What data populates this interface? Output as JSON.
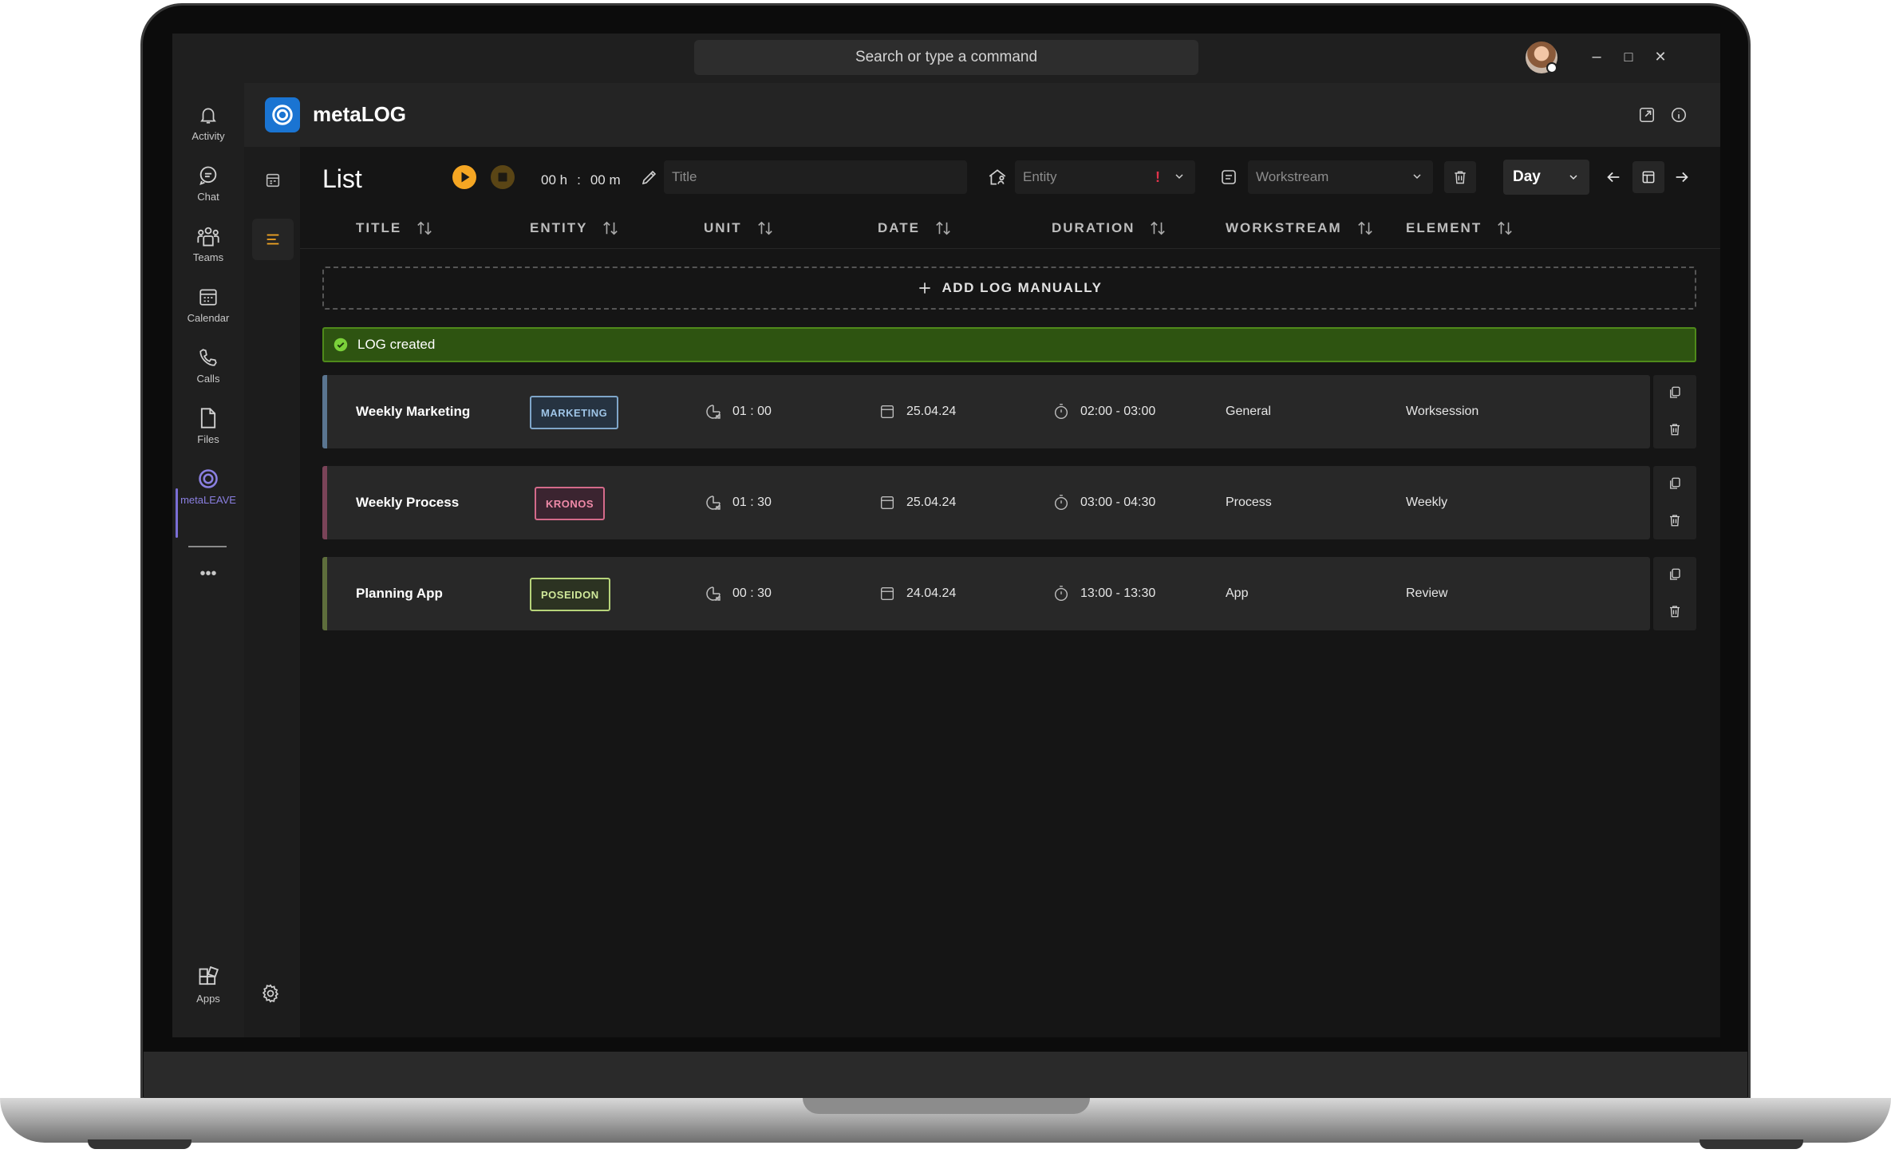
{
  "titlebar": {
    "search_placeholder": "Search or type a command",
    "minimize": "–",
    "maximize": "□",
    "close": "✕"
  },
  "rail": {
    "items": [
      {
        "label": "Activity",
        "icon": "bell-icon"
      },
      {
        "label": "Chat",
        "icon": "chat-icon"
      },
      {
        "label": "Teams",
        "icon": "teams-icon"
      },
      {
        "label": "Calendar",
        "icon": "calendar-icon"
      },
      {
        "label": "Calls",
        "icon": "phone-icon"
      },
      {
        "label": "Files",
        "icon": "file-icon"
      },
      {
        "label": "metaLEAVE",
        "icon": "metaleave-icon"
      }
    ],
    "more": "•••",
    "apps_label": "Apps"
  },
  "app": {
    "name": "metaLOG"
  },
  "toolbar": {
    "page_title": "List",
    "timer_hours": "00 h",
    "timer_sep": ":",
    "timer_minutes": "00 m",
    "title_placeholder": "Title",
    "entity_placeholder": "Entity",
    "entity_warning": "!",
    "workstream_placeholder": "Workstream",
    "period": "Day"
  },
  "table": {
    "columns": [
      "TITLE",
      "ENTITY",
      "UNIT",
      "DATE",
      "DURATION",
      "WORKSTREAM",
      "ELEMENT"
    ],
    "add_label": "ADD LOG MANUALLY",
    "toast": "LOG created",
    "rows": [
      {
        "title": "Weekly Marketing",
        "entity": "MARKETING",
        "unit": "01 : 00",
        "date": "25.04.24",
        "duration": "02:00 - 03:00",
        "workstream": "General",
        "element": "Worksession",
        "color": "#7fa6c9"
      },
      {
        "title": "Weekly Process",
        "entity": "KRONOS",
        "unit": "01 : 30",
        "date": "25.04.24",
        "duration": "03:00 - 04:30",
        "workstream": "Process",
        "element": "Weekly",
        "color": "#d46a8a"
      },
      {
        "title": "Planning App",
        "entity": "POSEIDON",
        "unit": "00 : 30",
        "date": "24.04.24",
        "duration": "13:00 - 13:30",
        "workstream": "App",
        "element": "Review",
        "color": "#b7d47a"
      }
    ]
  },
  "colors": {
    "accent_play": "#f5a623",
    "toast_bg": "#2e5411",
    "brand": "#1a74d2",
    "active_rail": "#7b6fd6"
  }
}
